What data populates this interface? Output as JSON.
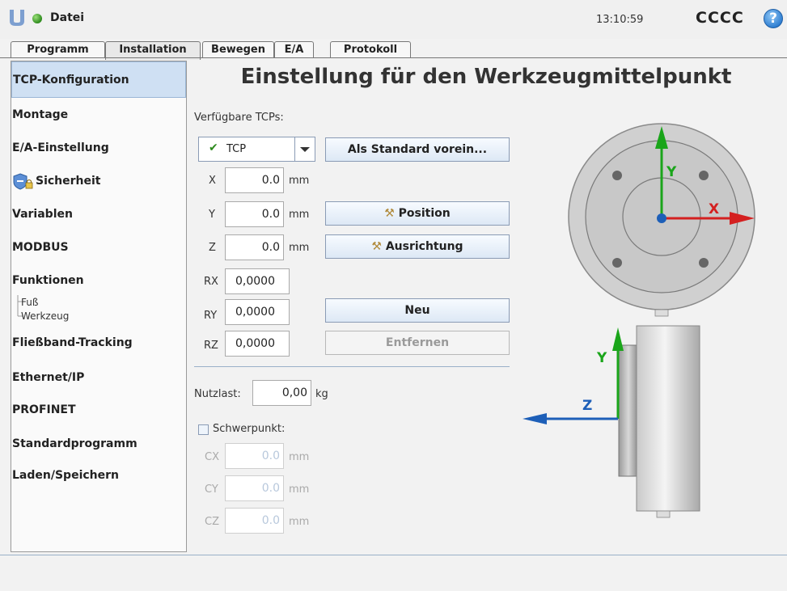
{
  "header": {
    "file_menu": "Datei",
    "time": "13:10:59",
    "robot_name": "CCCC",
    "help_symbol": "?"
  },
  "tabs": [
    "Programm",
    "Installation",
    "Bewegen",
    "E/A",
    "Protokoll"
  ],
  "sidebar": {
    "items": [
      "TCP-Konfiguration",
      "Montage",
      "E/A-Einstellung",
      "Sicherheit",
      "Variablen",
      "MODBUS",
      "Funktionen",
      "Fließband-Tracking",
      "Ethernet/IP",
      "PROFINET",
      "Standardprogramm",
      "Laden/Speichern"
    ],
    "sub_items": [
      "Fuß",
      "Werkzeug"
    ]
  },
  "main": {
    "title": "Einstellung für den Werkzeugmittelpunkt",
    "available_label": "Verfügbare TCPs:",
    "tcp_selected": "TCP",
    "set_default_button": "Als Standard vorein...",
    "x_label": "X",
    "x_value": "0.0",
    "x_unit": "mm",
    "y_label": "Y",
    "y_value": "0.0",
    "y_unit": "mm",
    "z_label": "Z",
    "z_value": "0.0",
    "z_unit": "mm",
    "rx_label": "RX",
    "rx_value": "0,0000",
    "ry_label": "RY",
    "ry_value": "0,0000",
    "rz_label": "RZ",
    "rz_value": "0,0000",
    "position_button": "Position",
    "orientation_button": "Ausrichtung",
    "new_button": "Neu",
    "remove_button": "Entfernen",
    "payload_label": "Nutzlast:",
    "payload_value": "0,00",
    "payload_unit": "kg",
    "cog_label": "Schwerpunkt:",
    "cx_label": "CX",
    "cx_value": "0.0",
    "cx_unit": "mm",
    "cy_label": "CY",
    "cy_value": "0.0",
    "cy_unit": "mm",
    "cz_label": "CZ",
    "cz_value": "0.0",
    "cz_unit": "mm"
  },
  "diagram": {
    "front_x": "X",
    "front_y": "Y",
    "side_y": "Y",
    "side_z": "Z"
  },
  "colors": {
    "axis_x": "#d42020",
    "axis_y": "#1aa51a",
    "axis_z": "#1d5fb8",
    "selection": "#cfe0f3"
  }
}
